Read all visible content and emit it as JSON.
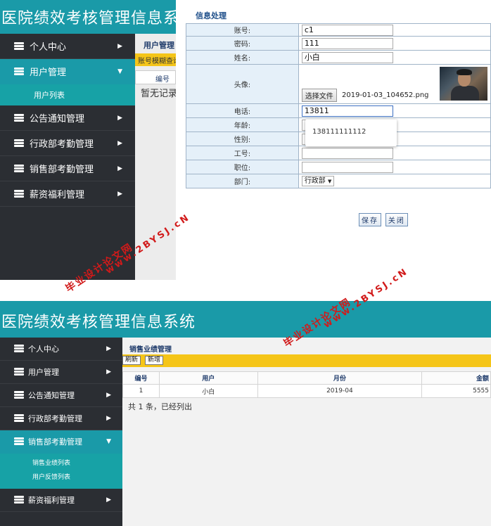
{
  "top": {
    "header_title": "医院绩效考核管理信息系统",
    "menu": [
      {
        "label": "个人中心",
        "arrow": "▶"
      },
      {
        "label": "用户管理",
        "arrow": "▼",
        "active": true,
        "sub": [
          "用户列表"
        ]
      },
      {
        "label": "公告通知管理",
        "arrow": "▶"
      },
      {
        "label": "行政部考勤管理",
        "arrow": "▶"
      },
      {
        "label": "销售部考勤管理",
        "arrow": "▶"
      },
      {
        "label": "薪资福利管理",
        "arrow": "▶"
      }
    ],
    "content": {
      "title": "用户管理",
      "search_label": "账号模糊查询",
      "col_first": "编号",
      "empty_text": "暂无记录"
    },
    "dialog": {
      "title": "信息处理",
      "fields": {
        "account": {
          "label": "账号:",
          "value": "c1"
        },
        "password": {
          "label": "密码:",
          "value": "111"
        },
        "name": {
          "label": "姓名:",
          "value": "小白"
        },
        "avatar": {
          "label": "头像:",
          "button": "选择文件",
          "filename": "2019-01-03_104652.png"
        },
        "phone": {
          "label": "电话:",
          "value": "13811"
        },
        "age": {
          "label": "年龄:",
          "value": ""
        },
        "gender": {
          "label": "性别:",
          "value": ""
        },
        "job_no": {
          "label": "工号:",
          "value": ""
        },
        "position": {
          "label": "职位:",
          "value": ""
        },
        "department": {
          "label": "部门:",
          "value": "行政部",
          "caret": "▼"
        }
      },
      "autocomplete": "138111111112",
      "save_label": "保存",
      "close_label": "关闭"
    }
  },
  "bottom": {
    "header_title": "医院绩效考核管理信息系统",
    "menu": [
      {
        "label": "个人中心",
        "arrow": "▶"
      },
      {
        "label": "用户管理",
        "arrow": "▶"
      },
      {
        "label": "公告通知管理",
        "arrow": "▶"
      },
      {
        "label": "行政部考勤管理",
        "arrow": "▶"
      },
      {
        "label": "销售部考勤管理",
        "arrow": "▼",
        "active": true,
        "sub": [
          "销售业绩列表",
          "用户反馈列表"
        ]
      },
      {
        "label": "薪资福利管理",
        "arrow": "▶"
      }
    ],
    "content": {
      "title": "销售业绩管理",
      "refresh_label": "刷新",
      "add_label": "新增",
      "columns": [
        "编号",
        "用户",
        "月份",
        "金额"
      ],
      "rows": [
        [
          "1",
          "小白",
          "2019-04",
          "5555"
        ]
      ],
      "summary": "共 1 条，已经列出"
    }
  },
  "watermarks": {
    "site": "www.2BYSJ.cN",
    "name": "毕业设计论文网"
  },
  "colors": {
    "teal": "#1a9aa8",
    "sidebar": "#2b2e33",
    "toolbar_yellow": "#f5c518",
    "watermark_red": "#d11a1a"
  }
}
